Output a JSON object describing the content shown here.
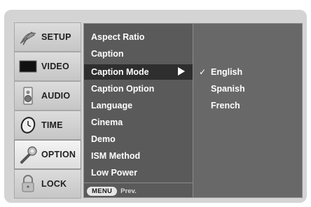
{
  "sidebar": {
    "items": [
      {
        "label": "SETUP",
        "icon": "satellite-dish-icon"
      },
      {
        "label": "VIDEO",
        "icon": "tv-screen-icon"
      },
      {
        "label": "AUDIO",
        "icon": "speaker-icon"
      },
      {
        "label": "TIME",
        "icon": "clock-icon"
      },
      {
        "label": "OPTION",
        "icon": "wrench-icon",
        "active": true
      },
      {
        "label": "LOCK",
        "icon": "padlock-icon"
      }
    ]
  },
  "submenu": {
    "items": [
      "Aspect Ratio",
      "Caption",
      "Caption Mode",
      "Caption Option",
      "Language",
      "Cinema",
      "Demo",
      "ISM Method",
      "Low Power"
    ],
    "selected_index": 2,
    "footer": {
      "key": "MENU",
      "label": "Prev."
    }
  },
  "options": {
    "items": [
      "English",
      "Spanish",
      "French"
    ],
    "selected_index": 0,
    "check_mark": "✓"
  },
  "colors": {
    "submenu_bg": "#5a5a5a",
    "highlight_bg": "#2e2e2e",
    "options_bg": "#686868",
    "frame_bg": "#d4d4d4"
  }
}
